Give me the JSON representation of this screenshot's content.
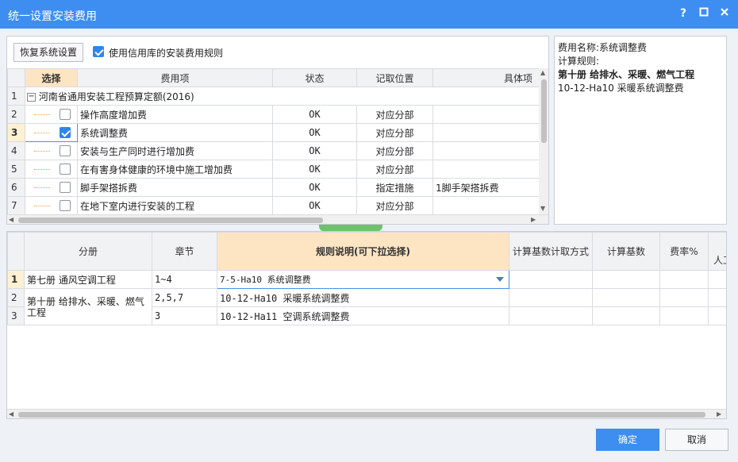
{
  "window": {
    "title": "统一设置安装费用",
    "help": "?",
    "maximize": "□",
    "close": "✕"
  },
  "toolbar": {
    "restore_label": "恢复系统设置",
    "use_credit_label": "使用信用库的安装费用规则",
    "use_credit_checked": true
  },
  "upper_grid": {
    "columns": [
      "选择",
      "费用项",
      "状态",
      "记取位置",
      "具体项"
    ],
    "rows": [
      {
        "num": "1",
        "expand": "−",
        "name": "河南省通用安装工程预算定额(2016)",
        "status": "",
        "position": "",
        "item": "",
        "checked": null
      },
      {
        "num": "2",
        "name": "操作高度增加费",
        "status": "OK",
        "position": "对应分部",
        "item": "",
        "checked": false
      },
      {
        "num": "3",
        "name": "系统调整费",
        "status": "OK",
        "position": "对应分部",
        "item": "",
        "checked": true
      },
      {
        "num": "4",
        "name": "安装与生产同时进行增加费",
        "status": "OK",
        "position": "对应分部",
        "item": "",
        "checked": false
      },
      {
        "num": "5",
        "name": "在有害身体健康的环境中施工增加费",
        "status": "OK",
        "position": "对应分部",
        "item": "",
        "checked": false
      },
      {
        "num": "6",
        "name": "脚手架搭拆费",
        "status": "OK",
        "position": "指定措施",
        "item": "1脚手架搭拆费",
        "checked": false
      },
      {
        "num": "7",
        "name": "在地下室内进行安装的工程",
        "status": "OK",
        "position": "对应分部",
        "item": "",
        "checked": false
      }
    ]
  },
  "info_panel": {
    "fee_name": "费用名称:系统调整费",
    "rule_label": "计算规则:",
    "book": "第十册 给排水、采暖、燃气工程",
    "rule": "10-12-Ha10 采暖系统调整费"
  },
  "lower_grid": {
    "columns": [
      "分册",
      "章节",
      "规则说明(可下拉选择)",
      "计算基数计取方式",
      "计算基数",
      "费率%",
      "人工"
    ],
    "rows": [
      {
        "num": "1",
        "book": "第七册 通风空调工程",
        "chapter": "1~4",
        "rule": "7-5-Ha10 系统调整费"
      },
      {
        "num": "2",
        "book": "第十册 给排水、采暖、燃气工程",
        "chapter": "2,5,7",
        "rule": "10-12-Ha10 采暖系统调整费"
      },
      {
        "num": "3",
        "book": "",
        "chapter": "3",
        "rule": "10-12-Ha11 空调系统调整费"
      }
    ]
  },
  "footer": {
    "ok_label": "确定",
    "cancel_label": "取消"
  },
  "colors": {
    "titlebar": "#3d8ef0",
    "ok_button": "#3d8ef0",
    "selected_header": "#fde5c4"
  }
}
